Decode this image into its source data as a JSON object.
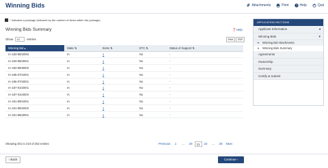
{
  "header": {
    "title": "Winning Bids",
    "actions": [
      {
        "label": "Attachments",
        "icon": "attachment-icon"
      },
      {
        "label": "Print",
        "icon": "print-icon"
      },
      {
        "label": "Help",
        "icon": "help-icon"
      },
      {
        "label": "Quit",
        "icon": "quit-icon"
      }
    ]
  },
  "note": {
    "text": "* Indicates a package (followed by the number of items within the package)"
  },
  "summary": {
    "title": "Winning Bids Summary",
    "help_label": "Help",
    "length_prefix": "Show",
    "length_value": "10",
    "length_suffix": "entries",
    "export_buttons": [
      "Print",
      "PDF"
    ]
  },
  "table": {
    "headers": [
      "Winning Bid",
      "State",
      "Items",
      "ETC",
      "Status of Support"
    ],
    "rows": [
      {
        "bid": "IA-183-9602094",
        "state": "IA",
        "items": "1",
        "etc": "No",
        "status": "-"
      },
      {
        "bid": "IA-183-9603001",
        "state": "IA",
        "items": "1",
        "etc": "No",
        "status": "-"
      },
      {
        "bid": "IA-183-9605002",
        "state": "IA",
        "items": "1",
        "etc": "No",
        "status": "-"
      },
      {
        "bid": "IA-185-0701001",
        "state": "IA",
        "items": "1",
        "etc": "No",
        "status": "-"
      },
      {
        "bid": "IA-185-0702001",
        "state": "IA",
        "items": "1",
        "etc": "No",
        "status": "-"
      },
      {
        "bid": "IA-187-0102001",
        "state": "IA",
        "items": "1",
        "etc": "No",
        "status": "-"
      },
      {
        "bid": "IA-187-0104004",
        "state": "IA",
        "items": "1",
        "etc": "No",
        "status": "-"
      },
      {
        "bid": "IA-191-9501001",
        "state": "IA",
        "items": "1",
        "etc": "No",
        "status": "-"
      },
      {
        "bid": "IA-191-9502002",
        "state": "IA",
        "items": "1",
        "etc": "No",
        "status": "-"
      },
      {
        "bid": "IA-191-9503001",
        "state": "IA",
        "items": "1",
        "etc": "No",
        "status": "-"
      }
    ]
  },
  "footer_info": {
    "showing": "Showing 201 to 210 of 252 entries"
  },
  "pagination": {
    "items": [
      "Previous",
      "1",
      "...",
      "20",
      "21",
      "22",
      "...",
      "26",
      "Next"
    ],
    "active": "21"
  },
  "sidebar": {
    "heading": "APPLICATION SECTIONS",
    "items": [
      {
        "label": "Applicant Information",
        "arrow": "◂"
      },
      {
        "label": "Winning Bids",
        "arrow": "▾"
      }
    ],
    "subitems": [
      {
        "label": "Winning Bid Attachments"
      },
      {
        "label": "Winning Bids Summary"
      }
    ],
    "more_items": [
      {
        "label": "Agreements"
      },
      {
        "label": "Ownership"
      },
      {
        "label": "Summary"
      },
      {
        "label": "Certify & Submit"
      }
    ]
  },
  "buttons": {
    "back": "‹ Back",
    "continue": "Continue ›"
  },
  "colors": {
    "brand": "#24477a",
    "link": "#1f5ea8"
  }
}
